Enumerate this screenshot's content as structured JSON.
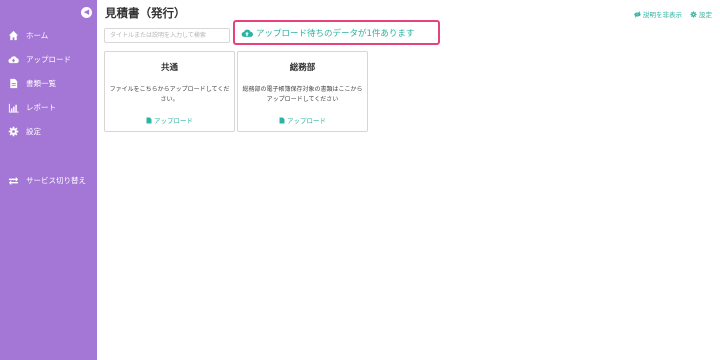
{
  "sidebar": {
    "collapse_icon": "chevron-left-icon",
    "items": [
      {
        "label": "ホーム",
        "icon": "home-icon"
      },
      {
        "label": "アップロード",
        "icon": "cloud-upload-icon"
      },
      {
        "label": "書類一覧",
        "icon": "document-icon"
      },
      {
        "label": "レポート",
        "icon": "bar-chart-icon"
      },
      {
        "label": "設定",
        "icon": "gear-icon"
      },
      {
        "label": "サービス切り替え",
        "icon": "switch-icon"
      }
    ],
    "bg_color": "#a476d6"
  },
  "header": {
    "title": "見積書（発行）",
    "hide_desc_label": "説明を非表示",
    "settings_label": "設定"
  },
  "search": {
    "placeholder": "タイトルまたは説明を入力して検索"
  },
  "notice": {
    "text": "アップロード待ちのデータが1件あります",
    "border_color": "#e8427a",
    "text_color": "#2bb3a3"
  },
  "cards": [
    {
      "title": "共通",
      "description": "ファイルをこちらからアップロードしてください。",
      "link_label": "アップロード"
    },
    {
      "title": "総務部",
      "description": "総務部の電子帳簿保存対象の書類はここからアップロードしてください",
      "link_label": "アップロード"
    }
  ]
}
